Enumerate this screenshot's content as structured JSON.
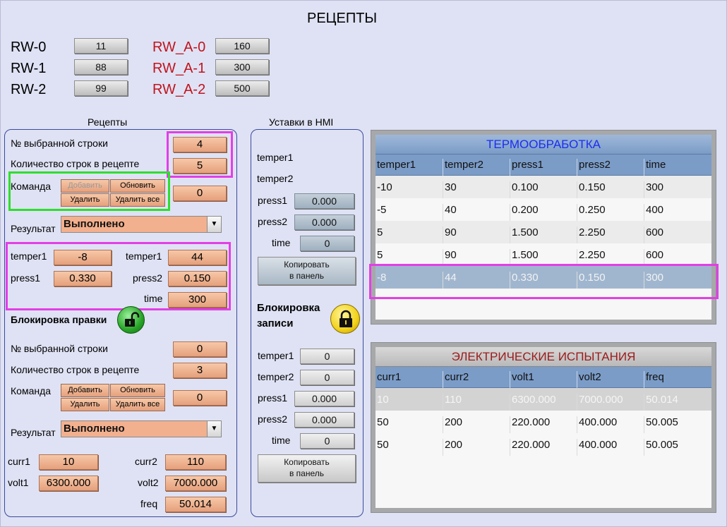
{
  "page_title": "РЕЦЕПТЫ",
  "top_vars": {
    "left": [
      {
        "label": "RW-0",
        "value": "11"
      },
      {
        "label": "RW-1",
        "value": "88"
      },
      {
        "label": "RW-2",
        "value": "99"
      }
    ],
    "right": [
      {
        "label": "RW_A-0",
        "value": "160"
      },
      {
        "label": "RW_A-1",
        "value": "300"
      },
      {
        "label": "RW_A-2",
        "value": "500"
      }
    ]
  },
  "recipes": {
    "title": "Рецепты",
    "selected_row_label": "№ выбранной строки",
    "selected_row": "4",
    "row_count_label": "Количество строк в рецепте",
    "row_count": "5",
    "command_label": "Команда",
    "btn_add": "Добавить",
    "btn_update": "Обновить",
    "btn_delete": "Удалить",
    "btn_delete_all": "Удалить все",
    "command_value": "0",
    "result_label": "Результат",
    "result_value": "Выполнено",
    "fields": {
      "temper1_label": "temper1",
      "temper1": "-8",
      "temper2_label": "temper1",
      "temper2": "44",
      "press1_label": "press1",
      "press1": "0.330",
      "press2_label": "press2",
      "press2": "0.150",
      "time_label": "time",
      "time": "300"
    },
    "edit_lock_label": "Блокировка правки",
    "selected_row2": "0",
    "row_count2": "3",
    "command_value2": "0",
    "result_value2": "Выполнено",
    "fields2": {
      "curr1_label": "curr1",
      "curr1": "10",
      "curr2_label": "curr2",
      "curr2": "110",
      "volt1_label": "volt1",
      "volt1": "6300.000",
      "volt2_label": "volt2",
      "volt2": "7000.000",
      "freq_label": "freq",
      "freq": "50.014"
    }
  },
  "hmi": {
    "title": "Уставки в HMI",
    "temper1_label": "temper1",
    "temper2_label": "temper2",
    "press1_label": "press1",
    "press1": "0.000",
    "press2_label": "press2",
    "press2": "0.000",
    "time_label": "time",
    "time": "0",
    "copy_line1": "Копировать",
    "copy_line2": "в панель",
    "lock_line1": "Блокировка",
    "lock_line2": "записи",
    "lower": {
      "temper1_label": "temper1",
      "temper1": "0",
      "temper2_label": "temper2",
      "temper2": "0",
      "press1_label": "press1",
      "press1": "0.000",
      "press2_label": "press2",
      "press2": "0.000",
      "time_label": "time",
      "time": "0"
    }
  },
  "thermo_table": {
    "title": "ТЕРМООБРАБОТКА",
    "columns": [
      "temper1",
      "temper2",
      "press1",
      "press2",
      "time"
    ],
    "rows": [
      [
        "-10",
        "30",
        "0.100",
        "0.150",
        "300"
      ],
      [
        "-5",
        "40",
        "0.200",
        "0.250",
        "400"
      ],
      [
        "5",
        "90",
        "1.500",
        "2.250",
        "600"
      ],
      [
        "5",
        "90",
        "1.500",
        "2.250",
        "600"
      ],
      [
        "-8",
        "44",
        "0.330",
        "0.150",
        "300"
      ]
    ],
    "selected_row": 4
  },
  "electric_table": {
    "title": "ЭЛЕКТРИЧЕСКИЕ ИСПЫТАНИЯ",
    "columns": [
      "curr1",
      "curr2",
      "volt1",
      "volt2",
      "freq"
    ],
    "rows": [
      [
        "10",
        "110",
        "6300.000",
        "7000.000",
        "50.014"
      ],
      [
        "50",
        "200",
        "220.000",
        "400.000",
        "50.005"
      ],
      [
        "50",
        "200",
        "220.000",
        "400.000",
        "50.005"
      ]
    ],
    "selected_row": 0
  },
  "colors": {
    "background": "#dfe2f4",
    "field_orange": "#eeb08d",
    "highlight_magenta": "#e23fe6",
    "highlight_green": "#2ede2e",
    "table_header_blue": "#7b9cc7",
    "thermo_title": "#1a2ff0",
    "electric_title": "#9b1b1b",
    "red_label": "#c0141e"
  }
}
